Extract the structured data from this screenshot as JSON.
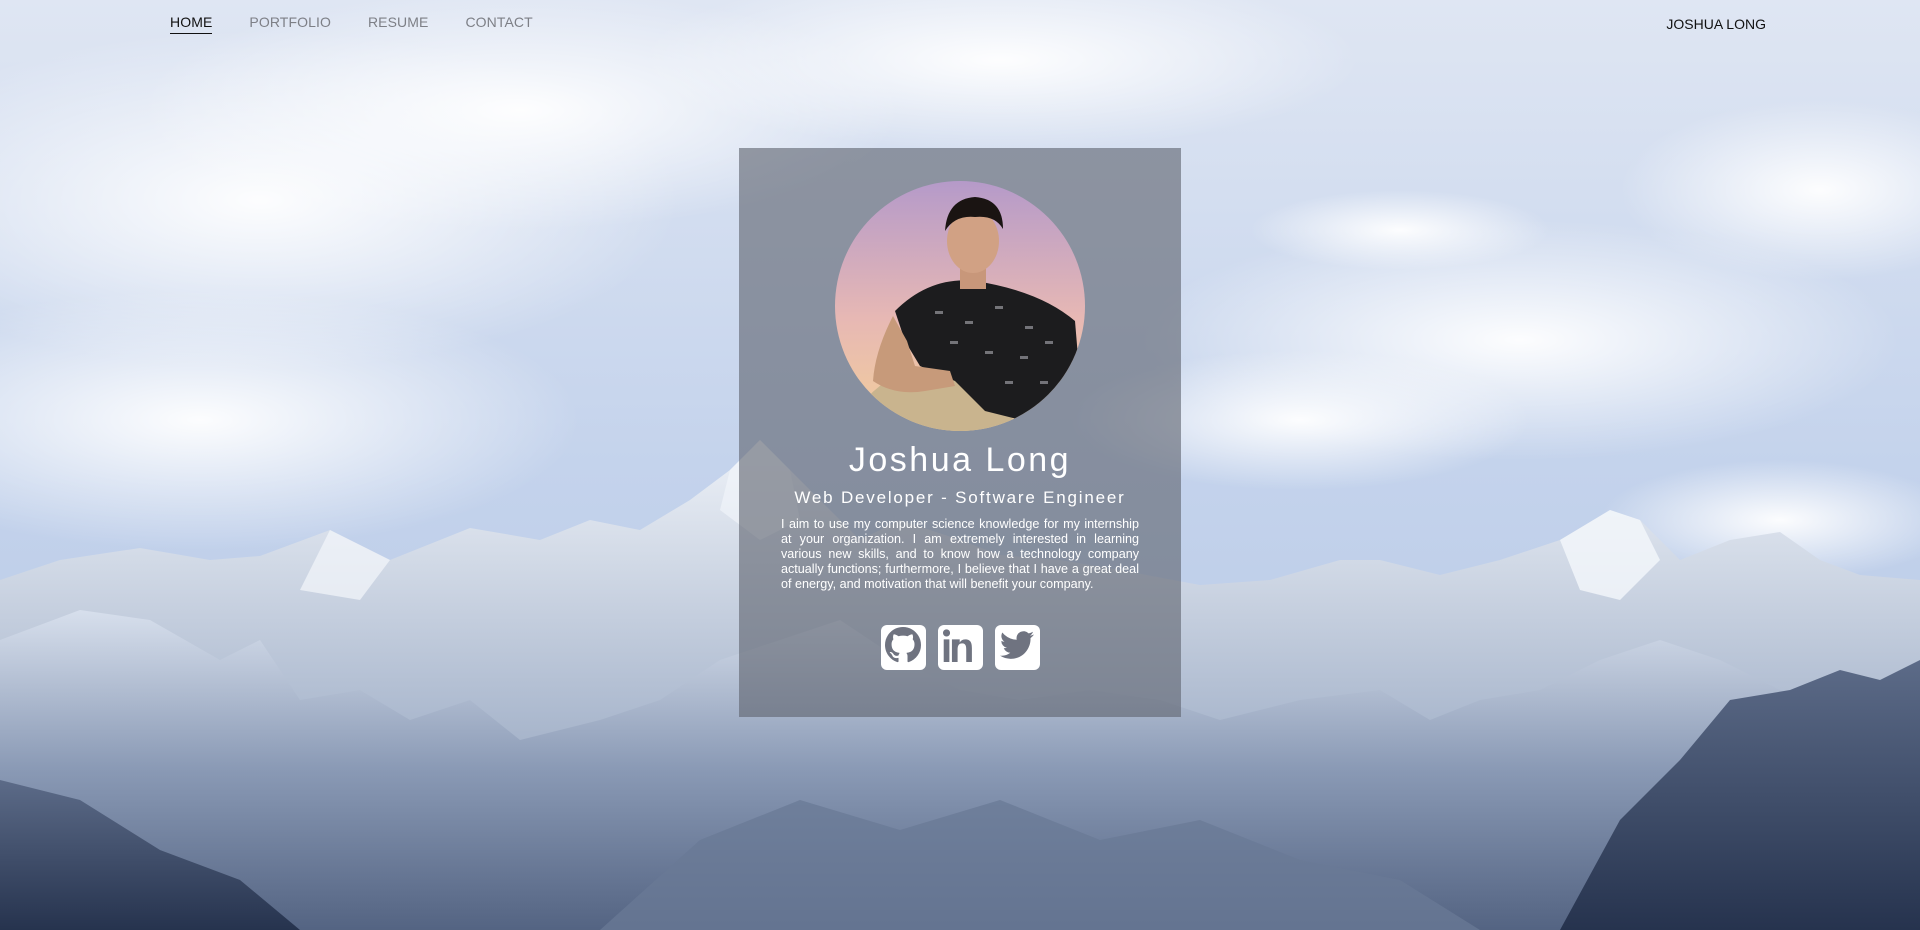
{
  "nav": {
    "items": [
      {
        "label": "HOME",
        "active": true
      },
      {
        "label": "PORTFOLIO",
        "active": false
      },
      {
        "label": "RESUME",
        "active": false
      },
      {
        "label": "CONTACT",
        "active": false
      }
    ],
    "brand": "JOSHUA LONG"
  },
  "profile": {
    "name": "Joshua Long",
    "role": "Web Developer - Software Engineer",
    "bio": "I aim to use my computer science knowledge for my internship at your organization. I am extremely interested in learning various new skills, and to know how a technology company actually functions; furthermore, I believe that I have a great deal of energy, and motivation that will benefit your company."
  },
  "socials": [
    {
      "icon": "github-icon"
    },
    {
      "icon": "linkedin-icon"
    },
    {
      "icon": "twitter-icon"
    }
  ],
  "colors": {
    "card_overlay": "#5f6470",
    "nav_active": "#111111",
    "nav_inactive": "#7d7f86",
    "sky": "#c9d6ea"
  }
}
